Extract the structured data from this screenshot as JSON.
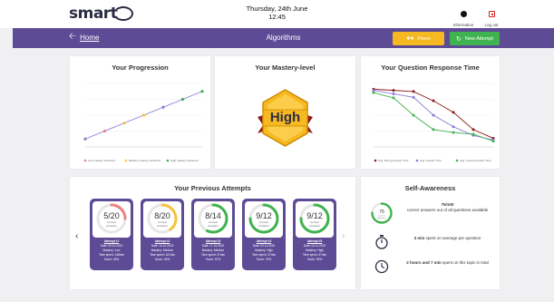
{
  "header": {
    "logo": "smart",
    "date": "Thursday, 24th June",
    "time": "12:45",
    "information_label": "Information",
    "logout_label": "Log out"
  },
  "nav": {
    "home_label": "Home",
    "title": "Algorithms",
    "peers_label": "Peers",
    "new_attempt_label": "New Attempt"
  },
  "progression": {
    "title": "Your Progression",
    "legend": [
      "Low mastery achieved",
      "Medium mastery achieved",
      "High mastery achieved"
    ],
    "colors": [
      "#f08080",
      "#f6c23e",
      "#3fb34f"
    ]
  },
  "mastery": {
    "title": "Your Mastery-level",
    "level": "High",
    "colors": {
      "badge": "#f6b921",
      "ribbon": "#8b1a1a",
      "badge_border": "#c98a00"
    }
  },
  "response_time": {
    "title": "Your Question Response Time",
    "legend": [
      "Avg. Wrong Answer Time",
      "Avg. Answer Time",
      "Avg. Correct Answer Time"
    ],
    "colors": [
      "#8b1a1a",
      "#8a7bd8",
      "#3fb34f"
    ]
  },
  "chart_data": [
    {
      "type": "line",
      "title": "Your Progression",
      "x": [
        1,
        2,
        3,
        4,
        5,
        6,
        7
      ],
      "series": [
        {
          "values": [
            1,
            2,
            3,
            4,
            5,
            6,
            7
          ]
        }
      ],
      "point_colors": [
        "#8a7bd8",
        "#f08080",
        "#f6c23e",
        "#f6c23e",
        "#8a7bd8",
        "#3fb34f",
        "#3fb34f"
      ],
      "ylim": [
        0,
        8
      ],
      "legend": [
        "Low mastery achieved",
        "Medium mastery achieved",
        "High mastery achieved"
      ]
    },
    {
      "type": "line",
      "title": "Your Question Response Time",
      "x": [
        1,
        2,
        3,
        4,
        5,
        6,
        7
      ],
      "series": [
        {
          "name": "Avg. Wrong Answer Time",
          "values": [
            10,
            9.8,
            9.6,
            8,
            6,
            3,
            1.5
          ],
          "color": "#8b1a1a"
        },
        {
          "name": "Avg. Answer Time",
          "values": [
            9.8,
            9.2,
            8.6,
            5.5,
            3.5,
            2,
            1.2
          ],
          "color": "#8a7bd8"
        },
        {
          "name": "Avg. Correct Answer Time",
          "values": [
            9.4,
            8.5,
            5.5,
            3,
            2.5,
            2.2,
            1
          ],
          "color": "#3fb34f"
        }
      ],
      "ylim": [
        0,
        11
      ],
      "legend": [
        "Avg. Wrong Answer Time",
        "Avg. Answer Time",
        "Avg. Correct Answer Time"
      ]
    }
  ],
  "attempts": {
    "title": "Your Previous Attempts",
    "items": [
      {
        "score": "5/20",
        "sub1": "Correct",
        "sub2": "Answers",
        "fraction": 0.25,
        "color": "#f08080",
        "name": "Attempt #1",
        "date": "Date: 09.10.2019",
        "mastery": "Mastery: Low",
        "time": "Time spent: 148min",
        "pct": "Score: 25%"
      },
      {
        "score": "8/20",
        "sub1": "Correct",
        "sub2": "Answers",
        "fraction": 0.4,
        "color": "#f6c23e",
        "name": "Attempt #2",
        "date": "Date: 14.10.2019",
        "mastery": "Mastery: Medium",
        "time": "Time spent: 167min",
        "pct": "Score: 40%"
      },
      {
        "score": "8/14",
        "sub1": "Correct",
        "sub2": "Answers",
        "fraction": 0.57,
        "color": "#3fb34f",
        "name": "Attempt #3",
        "date": "Date: 17.10.2019",
        "mastery": "Mastery: Medium",
        "time": "Time spent: 37min",
        "pct": "Score: 57%"
      },
      {
        "score": "9/12",
        "sub1": "Correct",
        "sub2": "Answers",
        "fraction": 0.75,
        "color": "#3fb34f",
        "name": "Attempt #4",
        "date": "Date: 02.11.2019",
        "mastery": "Mastery: High",
        "time": "Time spent: 37min",
        "pct": "Score: 75%"
      },
      {
        "score": "9/12",
        "sub1": "Correct",
        "sub2": "Answers",
        "fraction": 0.75,
        "color": "#3fb34f",
        "name": "Attempt #5",
        "date": "Date: 04.11.2019",
        "mastery": "Mastery: High",
        "time": "Time spent: 37min",
        "pct": "Score: 93%"
      }
    ]
  },
  "self_awareness": {
    "title": "Self-Awareness",
    "ring": {
      "value": "75",
      "sub1": "Correct",
      "sub2": "Answers",
      "fraction": 0.75,
      "color": "#3fb34f"
    },
    "stat1_bold": "75/100",
    "stat1_rest": "correct answers out of all questions available",
    "stat2_bold": "3 min",
    "stat2_rest": "spent on average per question",
    "stat3_bold": "2 hours and 7 min",
    "stat3_rest": "spent on this topic in total"
  }
}
